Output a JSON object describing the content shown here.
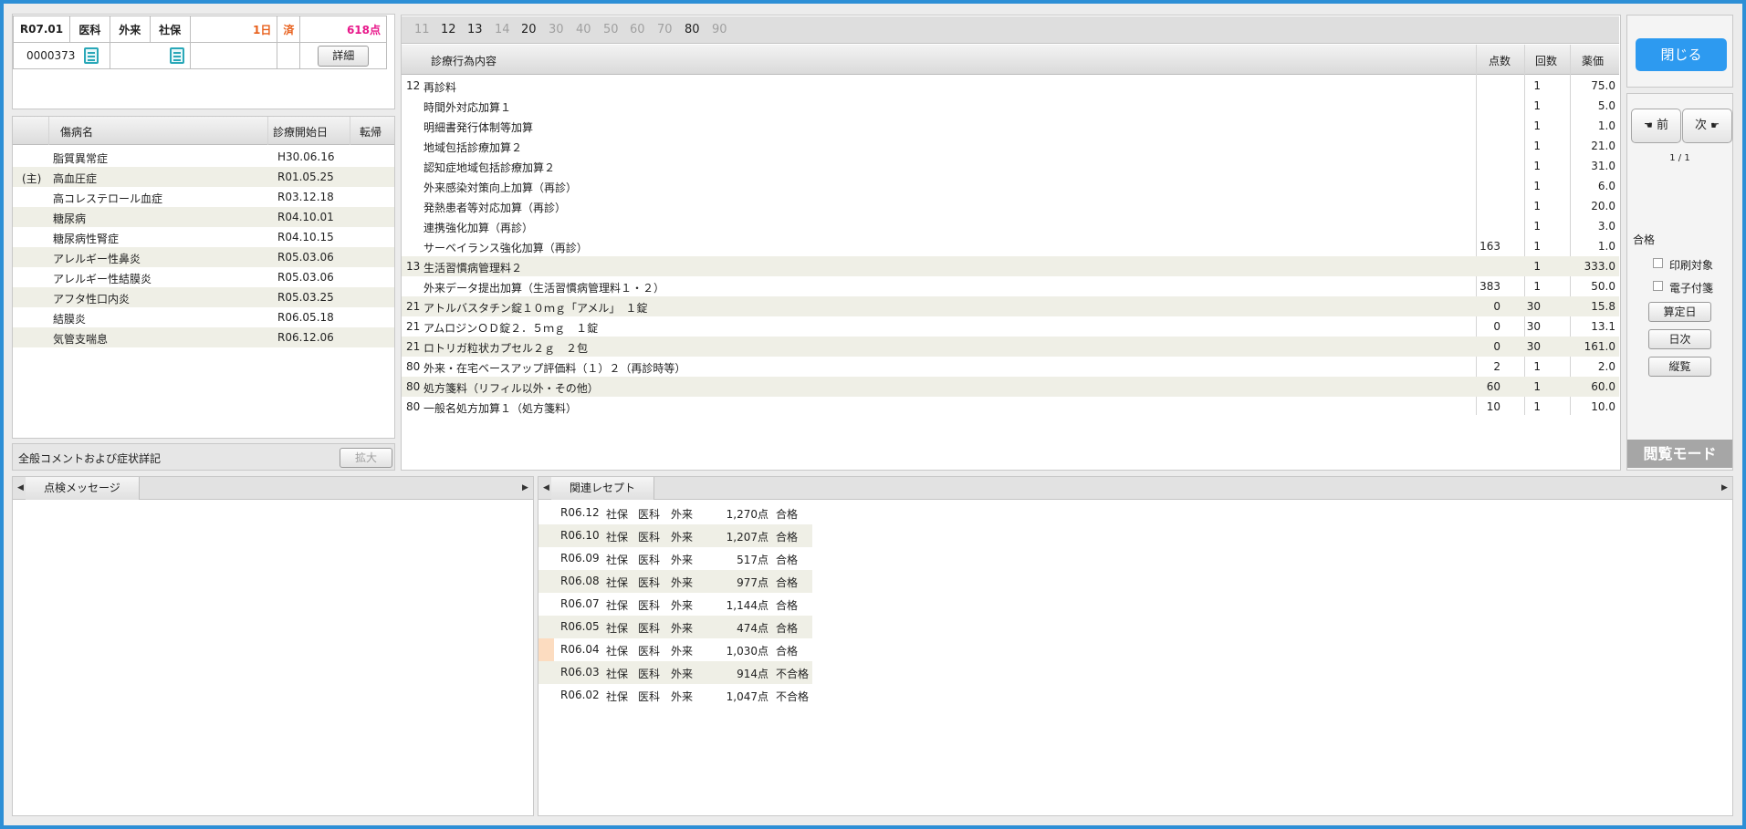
{
  "patient_header": {
    "era": "R07.01",
    "category": "医科",
    "visit": "外来",
    "insurance": "社保",
    "days": "1日",
    "status": "済",
    "points": "618点",
    "patient_id": "0000373",
    "details_button": "詳細"
  },
  "disease_list": {
    "columns": [
      "傷病名",
      "診療開始日",
      "転帰"
    ],
    "rows": [
      {
        "mark": "",
        "name": "脂質異常症",
        "start": "H30.06.16"
      },
      {
        "mark": "(主)",
        "name": "高血圧症",
        "start": "R01.05.25"
      },
      {
        "mark": "",
        "name": "高コレステロール血症",
        "start": "R03.12.18"
      },
      {
        "mark": "",
        "name": "糖尿病",
        "start": "R04.10.01"
      },
      {
        "mark": "",
        "name": "糖尿病性腎症",
        "start": "R04.10.15"
      },
      {
        "mark": "",
        "name": "アレルギー性鼻炎",
        "start": "R05.03.06"
      },
      {
        "mark": "",
        "name": "アレルギー性結膜炎",
        "start": "R05.03.06"
      },
      {
        "mark": "",
        "name": "アフタ性口内炎",
        "start": "R05.03.25"
      },
      {
        "mark": "",
        "name": "結膜炎",
        "start": "R06.05.18"
      },
      {
        "mark": "",
        "name": "気管支喘息",
        "start": "R06.12.06"
      }
    ]
  },
  "comment_bar": {
    "label": "全般コメントおよび症状詳記",
    "expand_button": "拡大"
  },
  "category_tabs": [
    "11",
    "12",
    "13",
    "14",
    "20",
    "30",
    "40",
    "50",
    "60",
    "70",
    "80",
    "90"
  ],
  "category_tabs_active": [
    "12",
    "13",
    "20",
    "80"
  ],
  "treatments": {
    "columns": [
      "診療行為内容",
      "点数",
      "回数",
      "薬価"
    ],
    "rows": [
      {
        "code": "12",
        "name": "再診料",
        "points": "",
        "count": "1",
        "price": "75.0"
      },
      {
        "code": "",
        "name": "時間外対応加算１",
        "points": "",
        "count": "1",
        "price": "5.0"
      },
      {
        "code": "",
        "name": "明細書発行体制等加算",
        "points": "",
        "count": "1",
        "price": "1.0"
      },
      {
        "code": "",
        "name": "地域包括診療加算２",
        "points": "",
        "count": "1",
        "price": "21.0"
      },
      {
        "code": "",
        "name": "認知症地域包括診療加算２",
        "points": "",
        "count": "1",
        "price": "31.0"
      },
      {
        "code": "",
        "name": "外来感染対策向上加算（再診）",
        "points": "",
        "count": "1",
        "price": "6.0"
      },
      {
        "code": "",
        "name": "発熱患者等対応加算（再診）",
        "points": "",
        "count": "1",
        "price": "20.0"
      },
      {
        "code": "",
        "name": "連携強化加算（再診）",
        "points": "",
        "count": "1",
        "price": "3.0"
      },
      {
        "code": "",
        "name": "サーベイランス強化加算（再診）",
        "points": "163",
        "count": "1",
        "price": "1.0"
      },
      {
        "code": "13",
        "name": "生活習慣病管理料２",
        "points": "",
        "count": "1",
        "price": "333.0"
      },
      {
        "code": "",
        "name": "外来データ提出加算（生活習慣病管理料１・２）",
        "points": "383",
        "count": "1",
        "price": "50.0"
      },
      {
        "code": "21",
        "name": "アトルバスタチン錠１０ｍｇ「アメル」　１錠",
        "points": "0",
        "count": "30",
        "price": "15.8"
      },
      {
        "code": "21",
        "name": "アムロジンＯＤ錠２．５ｍｇ　１錠",
        "points": "0",
        "count": "30",
        "price": "13.1"
      },
      {
        "code": "21",
        "name": "ロトリガ粒状カプセル２ｇ　２包",
        "points": "0",
        "count": "30",
        "price": "161.0"
      },
      {
        "code": "80",
        "name": "外来・在宅ベースアップ評価料（１）２（再診時等）",
        "points": "2",
        "count": "1",
        "price": "2.0"
      },
      {
        "code": "80",
        "name": "処方箋料（リフィル以外・その他）",
        "points": "60",
        "count": "1",
        "price": "60.0"
      },
      {
        "code": "80",
        "name": "一般名処方加算１（処方箋料）",
        "points": "10",
        "count": "1",
        "price": "10.0"
      }
    ]
  },
  "side_panel": {
    "close_button": "閉じる",
    "prev_button": "前",
    "next_button": "次",
    "page_indicator": "1 / 1",
    "result": "合格",
    "print_target": "印刷対象",
    "e_attach": "電子付箋",
    "calc_date_button": "算定日",
    "daily_button": "日次",
    "vertical_button": "縦覧",
    "mode": "閲覧モード"
  },
  "check_messages": {
    "tab_label": "点検メッセージ"
  },
  "related_receipts": {
    "tab_label": "関連レセプト",
    "rows": [
      {
        "month": "R06.12",
        "insurance": "社保",
        "category": "医科",
        "visit": "外来",
        "points": "1,270点",
        "result": "合格",
        "marked": false
      },
      {
        "month": "R06.10",
        "insurance": "社保",
        "category": "医科",
        "visit": "外来",
        "points": "1,207点",
        "result": "合格",
        "marked": false
      },
      {
        "month": "R06.09",
        "insurance": "社保",
        "category": "医科",
        "visit": "外来",
        "points": "517点",
        "result": "合格",
        "marked": false
      },
      {
        "month": "R06.08",
        "insurance": "社保",
        "category": "医科",
        "visit": "外来",
        "points": "977点",
        "result": "合格",
        "marked": false
      },
      {
        "month": "R06.07",
        "insurance": "社保",
        "category": "医科",
        "visit": "外来",
        "points": "1,144点",
        "result": "合格",
        "marked": false
      },
      {
        "month": "R06.05",
        "insurance": "社保",
        "category": "医科",
        "visit": "外来",
        "points": "474点",
        "result": "合格",
        "marked": true
      },
      {
        "month": "R06.04",
        "insurance": "社保",
        "category": "医科",
        "visit": "外来",
        "points": "1,030点",
        "result": "合格",
        "marked": true
      },
      {
        "month": "R06.03",
        "insurance": "社保",
        "category": "医科",
        "visit": "外来",
        "points": "914点",
        "result": "不合格",
        "marked": false
      },
      {
        "month": "R06.02",
        "insurance": "社保",
        "category": "医科",
        "visit": "外来",
        "points": "1,047点",
        "result": "不合格",
        "marked": false
      }
    ]
  },
  "colors": {
    "accent": "#2d9af0",
    "frame": "#2d8fd6",
    "days_text": "#e8601c",
    "points_text": "#e8178a",
    "stripe": "#efefe6",
    "mode_bar": "#a6a6a6"
  }
}
